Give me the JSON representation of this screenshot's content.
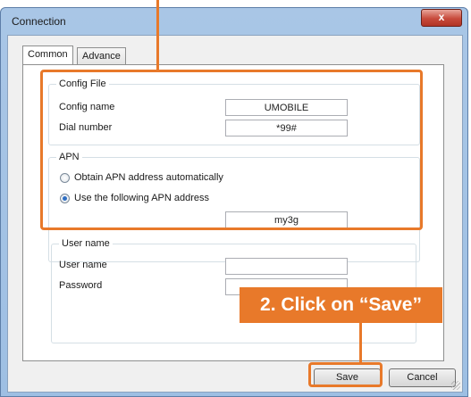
{
  "window": {
    "title": "Connection",
    "close_glyph": "x"
  },
  "tabs": [
    {
      "label": "Common",
      "active": true
    },
    {
      "label": "Advance",
      "active": false
    }
  ],
  "config_file": {
    "group_title": "Config File",
    "config_name_label": "Config name",
    "config_name_value": "UMOBILE",
    "dial_number_label": "Dial number",
    "dial_number_value": "*99#"
  },
  "apn": {
    "group_title": "APN",
    "option_auto": "Obtain APN address automatically",
    "option_manual": "Use the following APN address",
    "selected": "manual",
    "apn_value": "my3g"
  },
  "user": {
    "group_title": "User name",
    "user_name_label": "User name",
    "user_name_value": "",
    "password_label": "Password",
    "password_value": ""
  },
  "buttons": {
    "save": "Save",
    "cancel": "Cancel"
  },
  "annotation": {
    "callout_text": "2. Click on “Save”",
    "accent_color": "#e8792a"
  },
  "icons": [
    "close-icon",
    "radio-unchecked",
    "radio-checked",
    "resize-grip-icon"
  ]
}
